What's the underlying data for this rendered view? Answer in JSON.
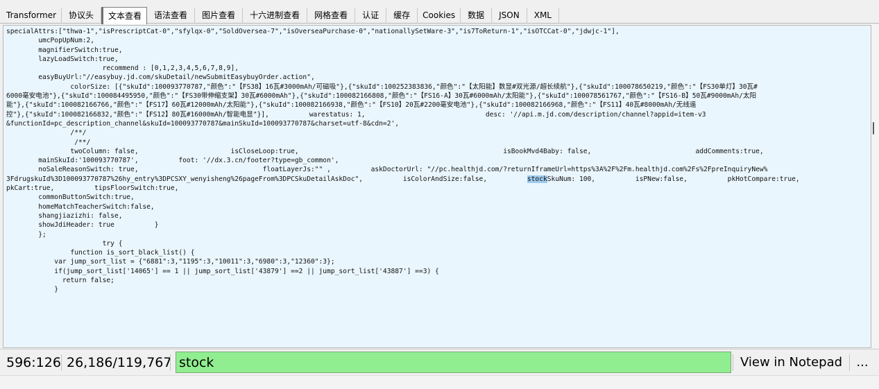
{
  "tabs": [
    {
      "label": "Transformer",
      "active": false
    },
    {
      "label": "协议头",
      "active": false
    },
    {
      "label": "文本查看",
      "active": true
    },
    {
      "label": "语法查看",
      "active": false
    },
    {
      "label": "图片查看",
      "active": false
    },
    {
      "label": "十六进制查看",
      "active": false
    },
    {
      "label": "网格查看",
      "active": false
    },
    {
      "label": "认证",
      "active": false
    },
    {
      "label": "缓存",
      "active": false
    },
    {
      "label": "Cookies",
      "active": false
    },
    {
      "label": "数据",
      "active": false
    },
    {
      "label": "JSON",
      "active": false
    },
    {
      "label": "XML",
      "active": false
    }
  ],
  "text_view": {
    "before_match": "specialAttrs:[\"thwa-1\",\"isPrescriptCat-0\",\"sfylqx-0\",\"SoldOversea-7\",\"isOverseaPurchase-0\",\"nationallySetWare-3\",\"is7ToReturn-1\",\"isOTCCat-0\",\"jdwjc-1\"],\n        umcPopUpNum:2,\n        magnifierSwitch:true,\n        lazyLoadSwitch:true,\n                        recommend : [0,1,2,3,4,5,6,7,8,9],\n        easyBuyUrl:\"//easybuy.jd.com/skuDetail/newSubmitEasybuyOrder.action\",\n                colorSize: [{\"skuId\":100093770787,\"颜色\":\"【FS38】16瓦#3000mAh/可磁吸\"},{\"skuId\":100252383836,\"颜色\":\"【太阳能】数显#双光源/超长续航\"},{\"skuId\":100078650219,\"颜色\":\"【FS30单灯】30瓦#\n6000毫安电池\"},{\"skuId\":100084495950,\"颜色\":\"【FS30带伸缩支架】30瓦#6000mAh\"},{\"skuId\":100082166808,\"颜色\":\"【FS16-A】30瓦#6000mAh/太阳能\"},{\"skuId\":100078561767,\"颜色\":\"【FS16-B】50瓦#9000mAh/太阳\n能\"},{\"skuId\":100082166766,\"颜色\":\"【FS17】60瓦#12000mAh/太阳能\"},{\"skuId\":100082166938,\"颜色\":\"【FS10】20瓦#2200毫安电池\"},{\"skuId\":100082166968,\"颜色\":\"【FS11】40瓦#8000mAh/无线遥\n控\"},{\"skuId\":100082166832,\"颜色\":\"【FS12】80瓦#16000mAh/智能电显\"}],          warestatus: 1,                              desc: '//api.m.jd.com/description/channel?appid=item-v3\n&functionId=pc_description_channel&skuId=100093770787&mainSkuId=100093770787&charset=utf-8&cdn=2',\n                /**/\n                 /**/\n                twoColumn: false,                       isCloseLoop:true,                                                   isBookMvd4Baby: false,                          addComments:true,\n        mainSkuId:'100093770787',          foot: '//dx.3.cn/footer?type=gb_common',\n        noSaleReasonSwitch: true,                               floatLayerJs:\"\" ,          askDoctorUrl: \"//pc.healthjd.com/?returnIframeUrl=https%3A%2F%2Fm.healthjd.com%2Fs%2FpreInquiryNew%\n3FdrugskuId%3D100093770787%26hy_entry%3DPCSXY_wenyisheng%26pageFrom%3DPCSkuDetailAskDoc\",          isColorAndSize:false,          ",
    "match": "stock",
    "after_match": "SkuNum: 100,          isPNew:false,          pkHotCompare:true,\npkCart:true,          tipsFloorSwitch:true,\n        commonButtonSwitch:true,\n        homeMatchTeacherSwitch:false,\n        shangjiazizhi: false,\n        showJdiHeader: true          }\n        };\n                        try {\n                function is_sort_black_list() {\n            var jump_sort_list = {\"6881\":3,\"1195\":3,\"10011\":3,\"6980\":3,\"12360\":3};\n            if(jump_sort_list['14065'] == 1 || jump_sort_list['43879'] ==2 || jump_sort_list['43887'] ==3) {\n              return false;\n            }"
  },
  "status": {
    "cursor_position": "596:126",
    "selection_info": "26,186/119,767",
    "find_value": "stock",
    "view_in_notepad_label": "View in Notepad",
    "more_label": "..."
  }
}
